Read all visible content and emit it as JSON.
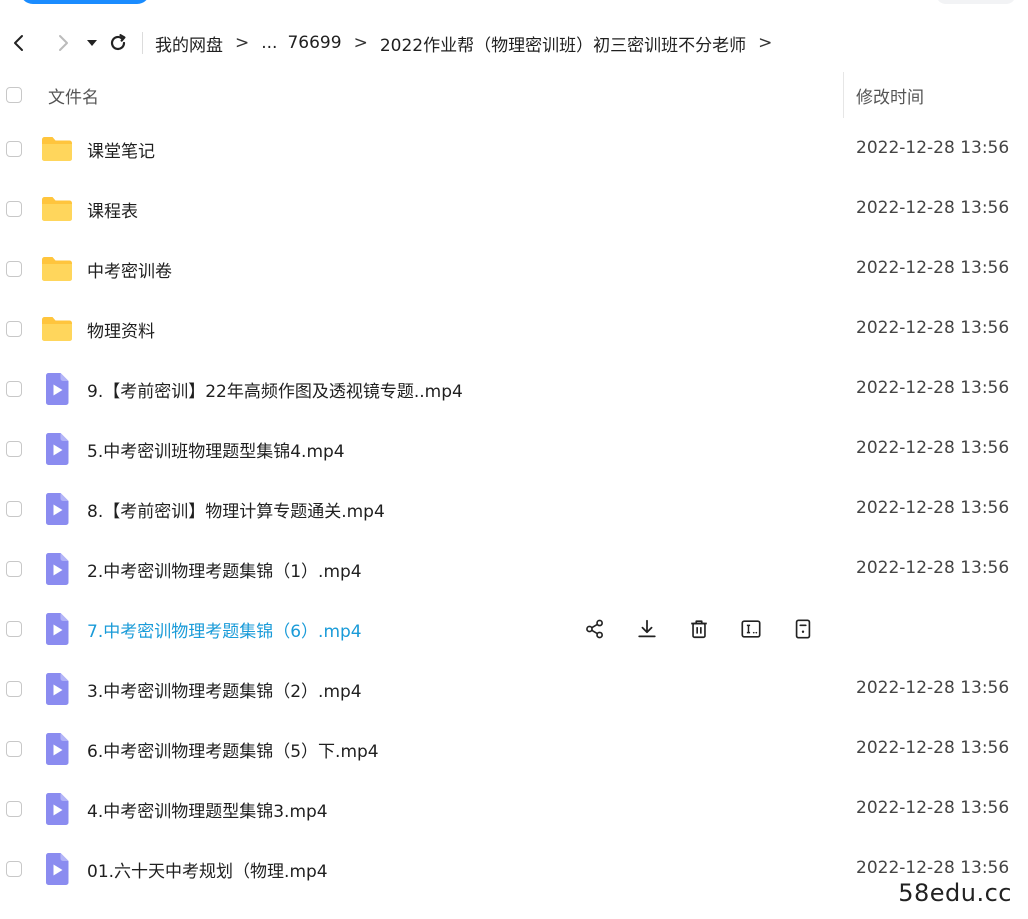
{
  "breadcrumb": {
    "items": [
      "我的网盘",
      "...",
      "76699",
      "2022作业帮（物理密训班）初三密训班不分老师"
    ],
    "separator": ">"
  },
  "header": {
    "name_label": "文件名",
    "time_label": "修改时间"
  },
  "files": [
    {
      "name": "课堂笔记",
      "type": "folder",
      "time": "2022-12-28 13:56"
    },
    {
      "name": "课程表",
      "type": "folder",
      "time": "2022-12-28 13:56"
    },
    {
      "name": "中考密训卷",
      "type": "folder",
      "time": "2022-12-28 13:56"
    },
    {
      "name": "物理资料",
      "type": "folder",
      "time": "2022-12-28 13:56"
    },
    {
      "name": "9.【考前密训】22年高频作图及透视镜专题..mp4",
      "type": "video",
      "time": "2022-12-28 13:56"
    },
    {
      "name": "5.中考密训班物理题型集锦4.mp4",
      "type": "video",
      "time": "2022-12-28 13:56"
    },
    {
      "name": "8.【考前密训】物理计算专题通关.mp4",
      "type": "video",
      "time": "2022-12-28 13:56"
    },
    {
      "name": "2.中考密训物理考题集锦（1）.mp4",
      "type": "video",
      "time": "2022-12-28 13:56"
    },
    {
      "name": "7.中考密训物理考题集锦（6）.mp4",
      "type": "video",
      "time": "",
      "hovered": true
    },
    {
      "name": "3.中考密训物理考题集锦（2）.mp4",
      "type": "video",
      "time": "2022-12-28 13:56"
    },
    {
      "name": "6.中考密训物理考题集锦（5）下.mp4",
      "type": "video",
      "time": "2022-12-28 13:56"
    },
    {
      "name": "4.中考密训物理题型集锦3.mp4",
      "type": "video",
      "time": "2022-12-28 13:56"
    },
    {
      "name": "01.六十天中考规划（物理.mp4",
      "type": "video",
      "time": "2022-12-28 13:56"
    }
  ],
  "row_actions": [
    "share-icon",
    "download-icon",
    "delete-icon",
    "rename-icon",
    "more-icon"
  ],
  "colors": {
    "folder": "#FFC53D",
    "video": "#8B8CF0",
    "hover_text": "#1A9BD8",
    "accent": "#1A8CFF"
  },
  "watermark": "58edu.cc"
}
